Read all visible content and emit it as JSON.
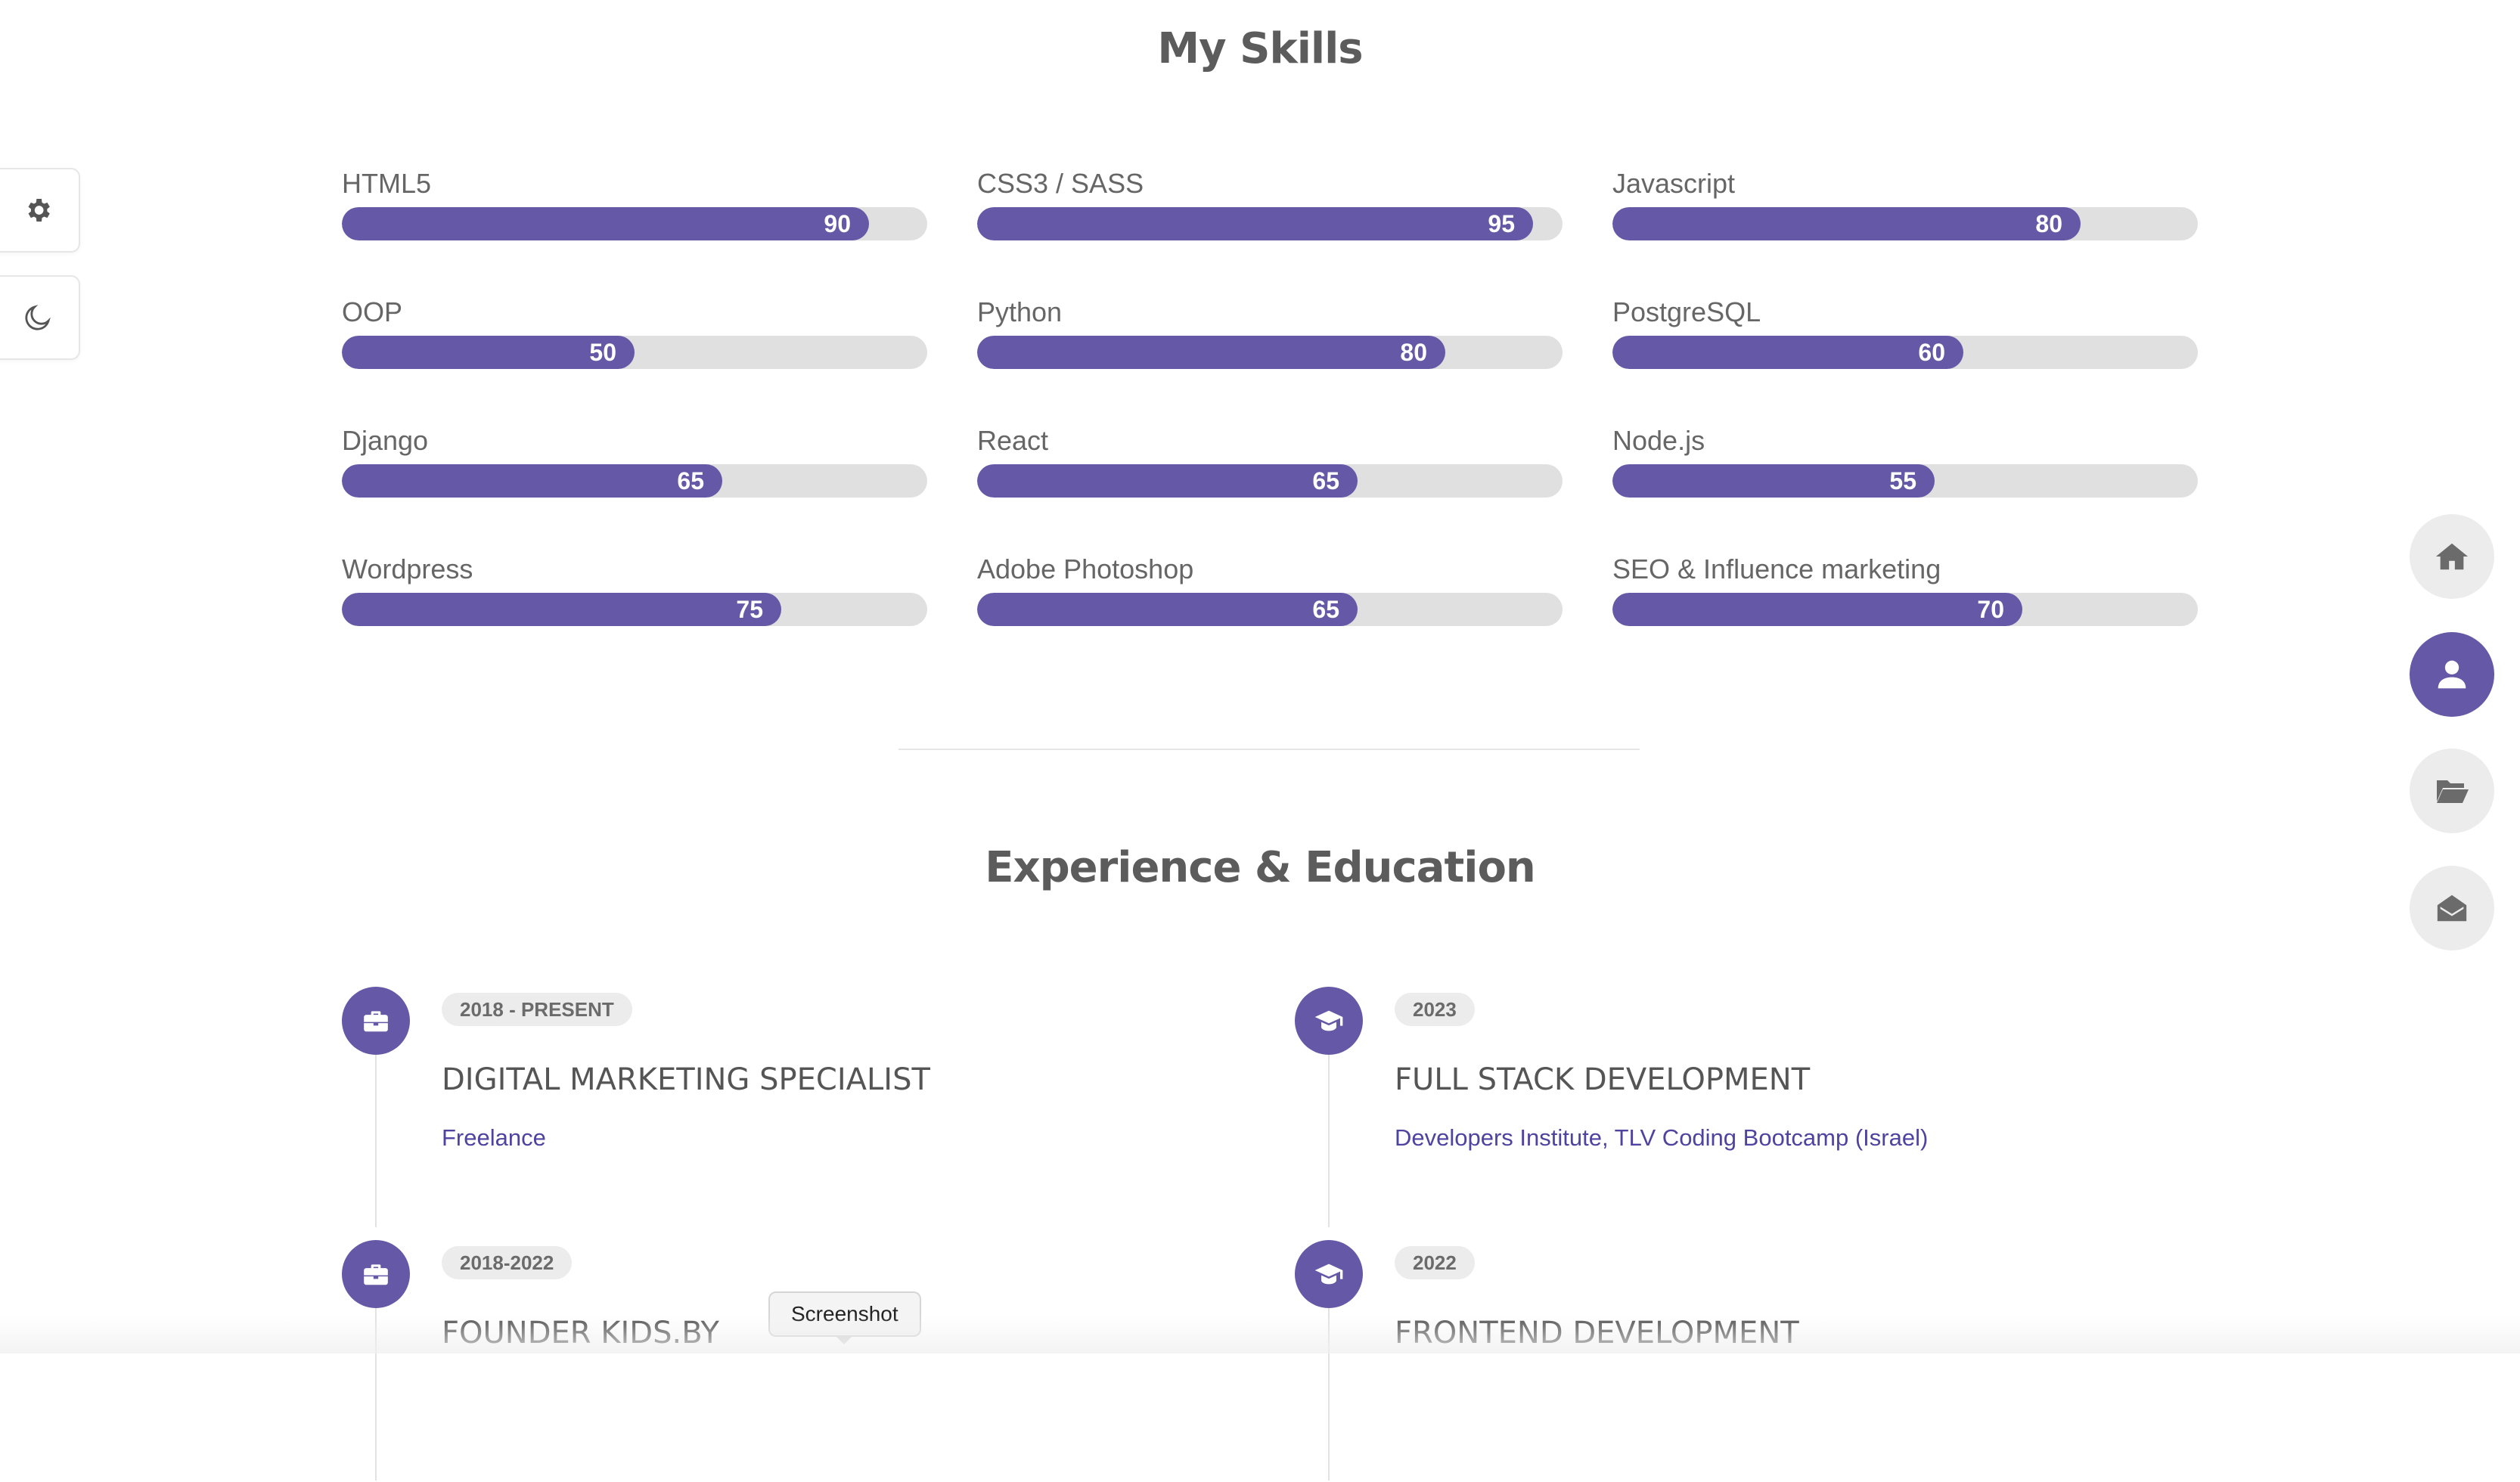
{
  "skills_section": {
    "title": "My Skills",
    "skills": [
      {
        "name": "HTML5",
        "value": 90
      },
      {
        "name": "CSS3 / SASS",
        "value": 95
      },
      {
        "name": "Javascript",
        "value": 80
      },
      {
        "name": "OOP",
        "value": 50
      },
      {
        "name": "Python",
        "value": 80
      },
      {
        "name": "PostgreSQL",
        "value": 60
      },
      {
        "name": "Django",
        "value": 65
      },
      {
        "name": "React",
        "value": 65
      },
      {
        "name": "Node.js",
        "value": 55
      },
      {
        "name": "Wordpress",
        "value": 75
      },
      {
        "name": "Adobe Photoshop",
        "value": 65
      },
      {
        "name": "SEO & Influence marketing",
        "value": 70
      }
    ]
  },
  "experience_section": {
    "title": "Experience & Education",
    "items": [
      {
        "icon": "briefcase-icon",
        "period": "2018 - PRESENT",
        "title": "DIGITAL MARKETING SPECIALIST",
        "org": "Freelance"
      },
      {
        "icon": "graduation-cap-icon",
        "period": "2023",
        "title": "FULL STACK DEVELOPMENT",
        "org": "Developers Institute, TLV Coding Bootcamp (Israel)"
      },
      {
        "icon": "briefcase-icon",
        "period": "2018-2022",
        "title": "FOUNDER KIDS.BY",
        "org": ""
      },
      {
        "icon": "graduation-cap-icon",
        "period": "2022",
        "title": "FRONTEND DEVELOPMENT",
        "org": ""
      }
    ]
  },
  "side_controls": {
    "settings_icon": "gear-icon",
    "theme_icon": "moon-icon"
  },
  "nav": {
    "items": [
      "home-icon",
      "user-icon",
      "folder-open-icon",
      "envelope-open-icon"
    ],
    "active": "user-icon"
  },
  "tooltip": {
    "label": "Screenshot"
  },
  "colors": {
    "accent": "#6558a6",
    "track": "#e0e0e0",
    "nav_bg": "#ececec"
  }
}
